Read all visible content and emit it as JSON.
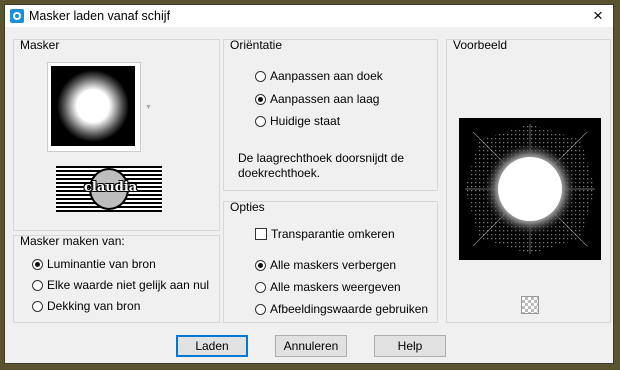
{
  "window": {
    "title": "Masker laden vanaf schijf",
    "close": "×"
  },
  "mask_group": {
    "label": "Masker"
  },
  "logo": {
    "text": "claudia"
  },
  "source_group": {
    "label": "Masker maken van:",
    "options": [
      {
        "label": "Luminantie van bron",
        "selected": true
      },
      {
        "label": "Elke waarde niet gelijk aan nul",
        "selected": false
      },
      {
        "label": "Dekking van bron",
        "selected": false
      }
    ]
  },
  "orientation_group": {
    "label": "Oriëntatie",
    "options": [
      {
        "label": "Aanpassen aan doek",
        "selected": false
      },
      {
        "label": "Aanpassen aan laag",
        "selected": true
      },
      {
        "label": "Huidige staat",
        "selected": false
      }
    ],
    "info": "De laagrechthoek doorsnijdt de doekrechthoek."
  },
  "options_group": {
    "label": "Opties",
    "invert": {
      "label": "Transparantie omkeren",
      "checked": false
    },
    "options": [
      {
        "label": "Alle maskers verbergen",
        "selected": true
      },
      {
        "label": "Alle maskers weergeven",
        "selected": false
      },
      {
        "label": "Afbeeldingswaarde gebruiken",
        "selected": false
      }
    ]
  },
  "preview_group": {
    "label": "Voorbeeld"
  },
  "buttons": {
    "load": "Laden",
    "cancel": "Annuleren",
    "help": "Help"
  }
}
